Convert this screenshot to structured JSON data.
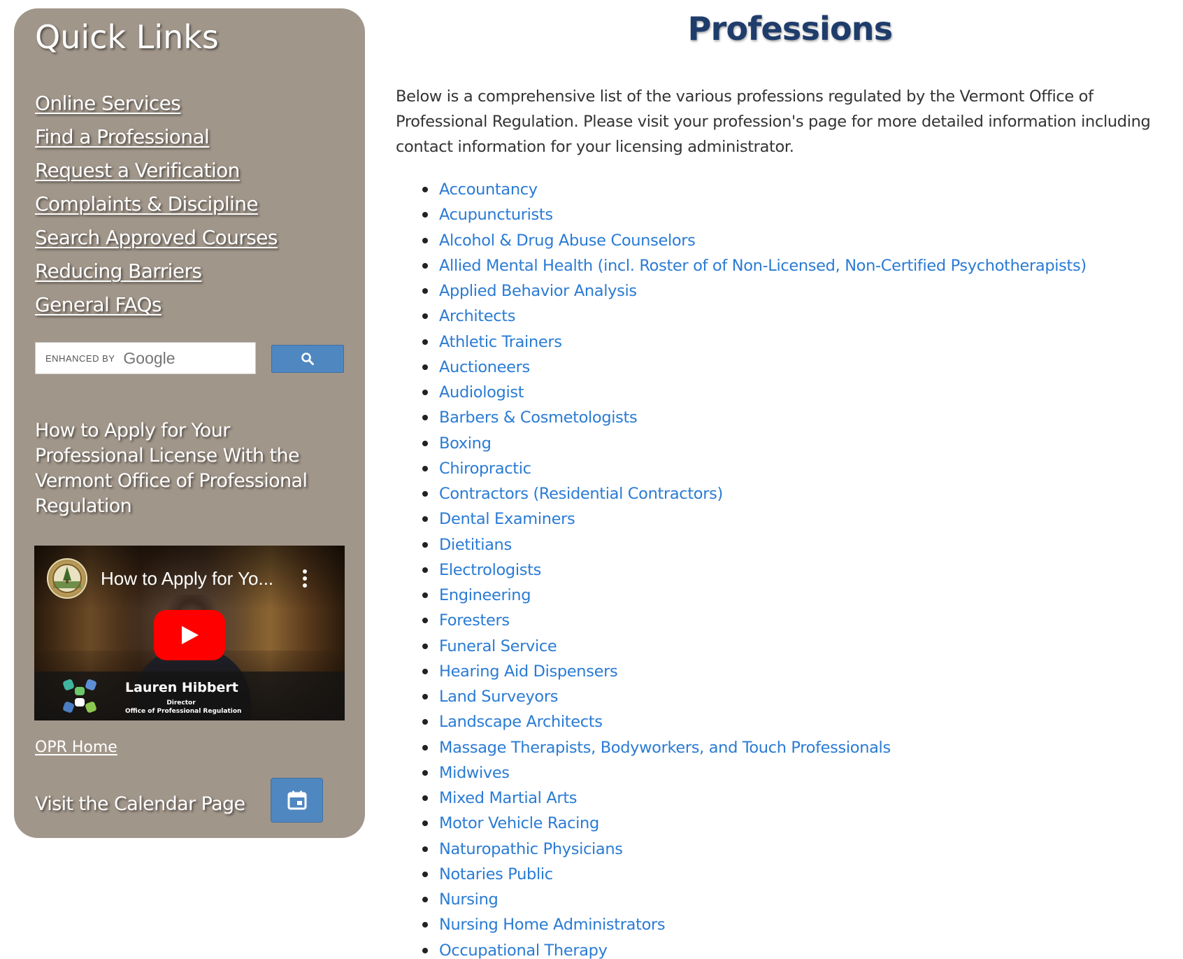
{
  "sidebar": {
    "title": "Quick Links",
    "links": [
      {
        "label": "Online Services"
      },
      {
        "label": "Find a Professional"
      },
      {
        "label": "Request a Verification"
      },
      {
        "label": "Complaints & Discipline"
      },
      {
        "label": "Search Approved Courses"
      },
      {
        "label": "Reducing Barriers"
      },
      {
        "label": "General FAQs"
      }
    ],
    "search": {
      "enhanced_label": "ENHANCED BY",
      "brand": "Google",
      "button_icon": "search-icon"
    },
    "apply_heading": "How to Apply for Your Professional License With the Vermont Office of Professional Regulation",
    "video": {
      "title": "How to Apply for Yo...",
      "presenter_name": "Lauren Hibbert",
      "presenter_role": "Director",
      "presenter_org": "Office of Professional Regulation",
      "play_icon": "play-icon",
      "menu_icon": "more-vert-icon"
    },
    "opr_home": "OPR Home",
    "calendar_label": "Visit the Calendar Page",
    "calendar_icon": "calendar-icon"
  },
  "main": {
    "title": "Professions",
    "intro": "Below is a comprehensive list of the various professions regulated by the Vermont Office of Professional Regulation. Please visit your profession's page for more detailed information including contact information for your licensing administrator.",
    "professions": [
      "Accountancy",
      "Acupuncturists",
      "Alcohol & Drug Abuse Counselors",
      "Allied Mental Health (incl. Roster of of Non-Licensed, Non-Certified Psychotherapists)",
      "Applied Behavior Analysis",
      "Architects",
      "Athletic Trainers",
      "Auctioneers",
      "Audiologist",
      "Barbers & Cosmetologists",
      "Boxing",
      "Chiropractic",
      "Contractors (Residential Contractors)",
      "Dental Examiners",
      "Dietitians",
      "Electrologists",
      "Engineering",
      "Foresters",
      "Funeral Service",
      "Hearing Aid Dispensers",
      "Land Surveyors",
      "Landscape Architects",
      "Massage Therapists, Bodyworkers, and Touch Professionals",
      "Midwives",
      "Mixed Martial Arts",
      "Motor Vehicle Racing",
      "Naturopathic Physicians",
      "Notaries Public",
      "Nursing",
      "Nursing Home Administrators",
      "Occupational Therapy"
    ]
  },
  "colors": {
    "sidebar_bg": "#a1968a",
    "accent_button": "#4f87c1",
    "link": "#2a7bd4",
    "title": "#1f3d6b",
    "youtube_red": "#ff0000"
  }
}
